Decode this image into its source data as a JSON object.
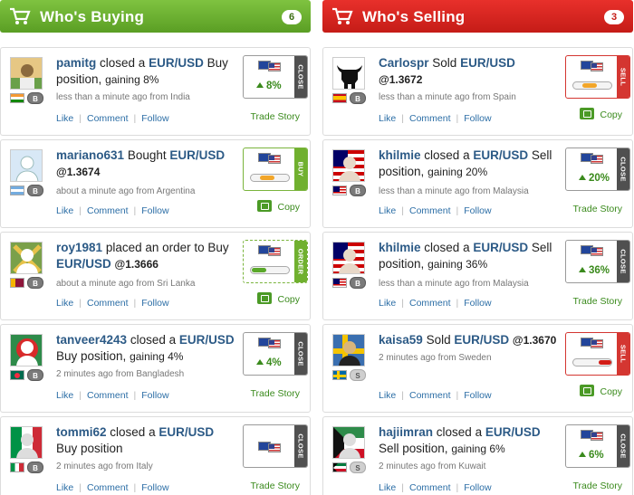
{
  "buying": {
    "title": "Who's Buying",
    "count": "6",
    "color": "#5a9e24",
    "items": [
      {
        "user": "pamitg",
        "action": "closed a",
        "pair": "EUR/USD",
        "after": "Buy position,",
        "gain": "gaining 8%",
        "price": "",
        "time": "less than a minute ago from India",
        "rank": "B",
        "box": "close",
        "box_value": "8%",
        "link": "Trade Story"
      },
      {
        "user": "mariano631",
        "action": "Bought",
        "pair": "EUR/USD",
        "after": "",
        "gain": "",
        "price": "@1.3674",
        "time": "about a minute ago from Argentina",
        "rank": "B",
        "box": "buy",
        "box_value": "",
        "link": "Copy"
      },
      {
        "user": "roy1981",
        "action": "placed an order to Buy",
        "pair": "EUR/USD",
        "after": "",
        "gain": "",
        "price": "@1.3666",
        "time": "about a minute ago from Sri Lanka",
        "rank": "B",
        "box": "order",
        "box_value": "",
        "link": "Copy"
      },
      {
        "user": "tanveer4243",
        "action": "closed a",
        "pair": "EUR/USD",
        "after": "Buy position,",
        "gain": "gaining 4%",
        "price": "",
        "time": "2 minutes ago from Bangladesh",
        "rank": "B",
        "box": "close",
        "box_value": "4%",
        "link": "Trade Story"
      },
      {
        "user": "tommi62",
        "action": "closed a",
        "pair": "EUR/USD",
        "after": "Buy position",
        "gain": "",
        "price": "",
        "time": "2 minutes ago from Italy",
        "rank": "B",
        "box": "close",
        "box_value": "",
        "link": "Trade Story"
      }
    ]
  },
  "selling": {
    "title": "Who's Selling",
    "count": "3",
    "color": "#c51c17",
    "items": [
      {
        "user": "Carlospr",
        "action": "Sold",
        "pair": "EUR/USD",
        "after": "",
        "gain": "",
        "price": "@1.3672",
        "time": "less than a minute ago from Spain",
        "rank": "B",
        "box": "sell",
        "box_value": "",
        "link": "Copy"
      },
      {
        "user": "khilmie",
        "action": "closed a",
        "pair": "EUR/USD",
        "after": "Sell position,",
        "gain": "gaining 20%",
        "price": "",
        "time": "less than a minute ago from Malaysia",
        "rank": "B",
        "box": "close",
        "box_value": "20%",
        "link": "Trade Story"
      },
      {
        "user": "khilmie",
        "action": "closed a",
        "pair": "EUR/USD",
        "after": "Sell position,",
        "gain": "gaining 36%",
        "price": "",
        "time": "less than a minute ago from Malaysia",
        "rank": "B",
        "box": "close",
        "box_value": "36%",
        "link": "Trade Story"
      },
      {
        "user": "kaisa59",
        "action": "Sold",
        "pair": "EUR/USD",
        "after": "",
        "gain": "",
        "price": "@1.3670",
        "time": "2 minutes ago from Sweden",
        "rank": "S",
        "box": "sell",
        "box_value": "",
        "link": "Copy"
      },
      {
        "user": "hajiimran",
        "action": "closed a",
        "pair": "EUR/USD",
        "after": "Sell position,",
        "gain": "gaining 6%",
        "price": "",
        "time": "2 minutes ago from Kuwait",
        "rank": "S",
        "box": "close",
        "box_value": "6%",
        "link": "Trade Story"
      }
    ]
  },
  "actions": {
    "like": "Like",
    "comment": "Comment",
    "follow": "Follow"
  },
  "tags": {
    "close": "CLOSE",
    "buy": "BUY",
    "sell": "SELL",
    "order": "ORDER"
  }
}
